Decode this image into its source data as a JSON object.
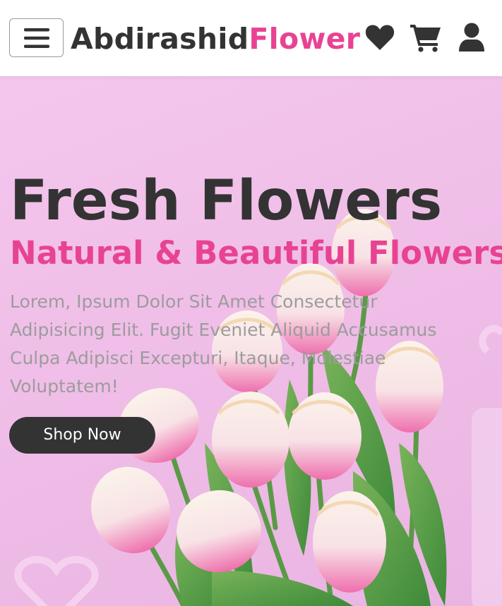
{
  "header": {
    "logo_main": "Abdirashid",
    "logo_accent": "Flower"
  },
  "icons": {
    "menu": "bars-icon",
    "heart": "heart-icon",
    "cart": "shopping-cart-icon",
    "user": "user-icon"
  },
  "hero": {
    "title": "Fresh Flowers",
    "subtitle": "Natural & Beautiful Flowers",
    "description": "Lorem, Ipsum Dolor Sit Amet Consectetur Adipisicing Elit. Fugit Eveniet Aliquid Accusamus Culpa Adipisci Excepturi, Itaque, Molestiae Voluptatem!",
    "button_label": "Shop Now"
  },
  "colors": {
    "accent": "#e84393",
    "dark": "#333333",
    "text_muted": "#9c9c9c",
    "hero_background": "#f0bfe8"
  }
}
